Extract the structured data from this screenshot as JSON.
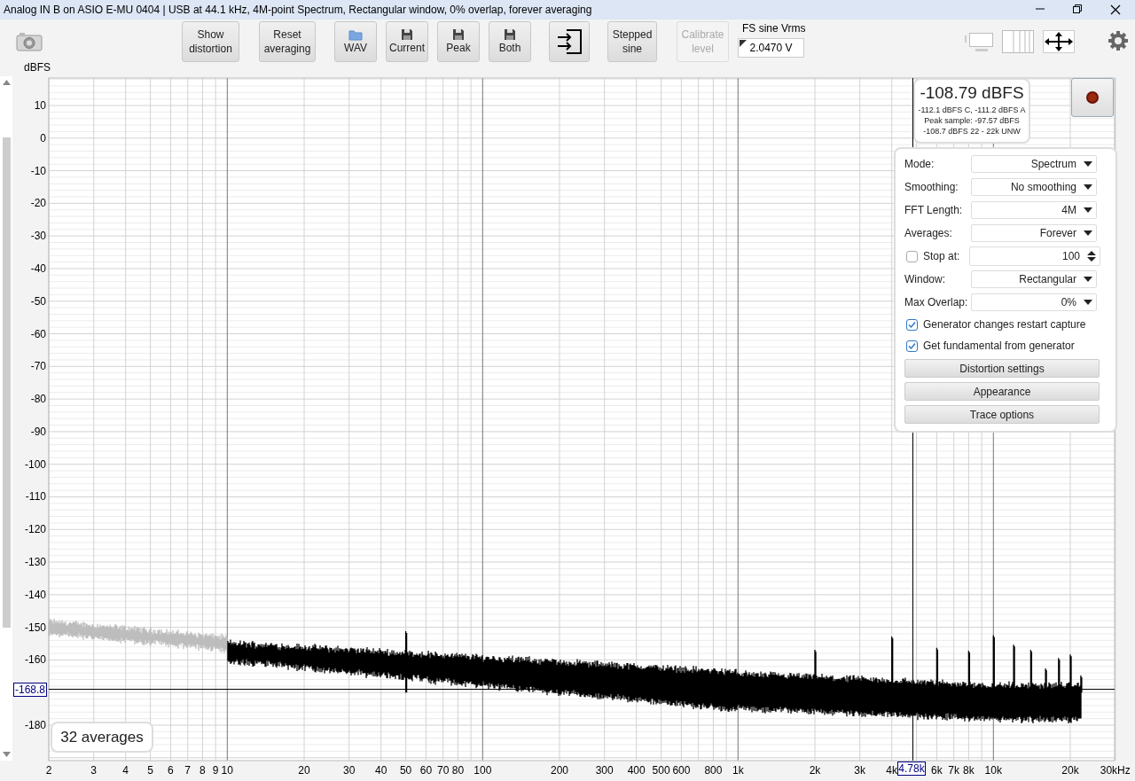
{
  "window": {
    "title": "Analog IN B on ASIO E-MU 0404 | USB at 44.1 kHz, 4M-point Spectrum, Rectangular window, 0% overlap, forever averaging"
  },
  "toolbar": {
    "buttons": [
      {
        "kind": "text",
        "label": "Show\ndistortion",
        "disabled": false
      },
      {
        "kind": "text",
        "label": "Reset\naveraging",
        "disabled": false
      },
      {
        "kind": "folder",
        "label": "WAV",
        "disabled": false
      },
      {
        "kind": "save",
        "label": "Current",
        "disabled": false
      },
      {
        "kind": "save",
        "label": "Peak",
        "disabled": false
      },
      {
        "kind": "save",
        "label": "Both",
        "disabled": false
      },
      {
        "kind": "import",
        "disabled": false
      },
      {
        "kind": "text",
        "label": "Stepped\nsine",
        "disabled": false
      },
      {
        "kind": "text",
        "label": "Calibrate\nlevel",
        "disabled": true
      }
    ],
    "fs_label": "FS sine Vrms",
    "fs_value": "2.0470 V"
  },
  "chart": {
    "y_unit": "dBFS",
    "y_ticks": [
      "10",
      "0",
      "-10",
      "-20",
      "-30",
      "-40",
      "-50",
      "-60",
      "-70",
      "-80",
      "-90",
      "-100",
      "-110",
      "-120",
      "-130",
      "-140",
      "-150",
      "-160",
      "-180"
    ],
    "x_ticks": [
      "2",
      "3",
      "4",
      "5",
      "6",
      "7",
      "8",
      "9",
      "10",
      "20",
      "30",
      "40",
      "50",
      "60",
      "70",
      "80",
      "100",
      "200",
      "300",
      "400",
      "500",
      "600",
      "800",
      "1k",
      "2k",
      "3k",
      "4k",
      "6k",
      "7k",
      "8k",
      "10k",
      "20k",
      "30kHz"
    ],
    "cursor_level": "-168.8",
    "cursor_freq": "4.78k",
    "averages": "32 averages"
  },
  "readout": {
    "main": "-108.79 dBFS",
    "lines": [
      "-112.1 dBFS C, -111.2 dBFS A",
      "Peak sample: -97.57 dBFS",
      "-108.7 dBFS 22 - 22k UNW"
    ]
  },
  "panel": {
    "rows": [
      {
        "kind": "dropdown",
        "label": "Mode:",
        "value": "Spectrum"
      },
      {
        "kind": "dropdown",
        "label": "Smoothing:",
        "value": "No smoothing"
      },
      {
        "kind": "dropdown",
        "label": "FFT Length:",
        "value": "4M"
      },
      {
        "kind": "dropdown",
        "label": "Averages:",
        "value": "Forever"
      },
      {
        "kind": "spinner",
        "label": "Stop at:",
        "value": "100",
        "checked": false
      },
      {
        "kind": "dropdown",
        "label": "Window:",
        "value": "Rectangular"
      },
      {
        "kind": "dropdown",
        "label": "Max Overlap:",
        "value": "0%"
      },
      {
        "kind": "checkbox",
        "label": "Generator changes restart capture",
        "checked": true
      },
      {
        "kind": "checkbox",
        "label": "Get fundamental from generator",
        "checked": true
      },
      {
        "kind": "button",
        "label": "Distortion settings"
      },
      {
        "kind": "button",
        "label": "Appearance"
      },
      {
        "kind": "button",
        "label": "Trace options"
      }
    ]
  }
}
